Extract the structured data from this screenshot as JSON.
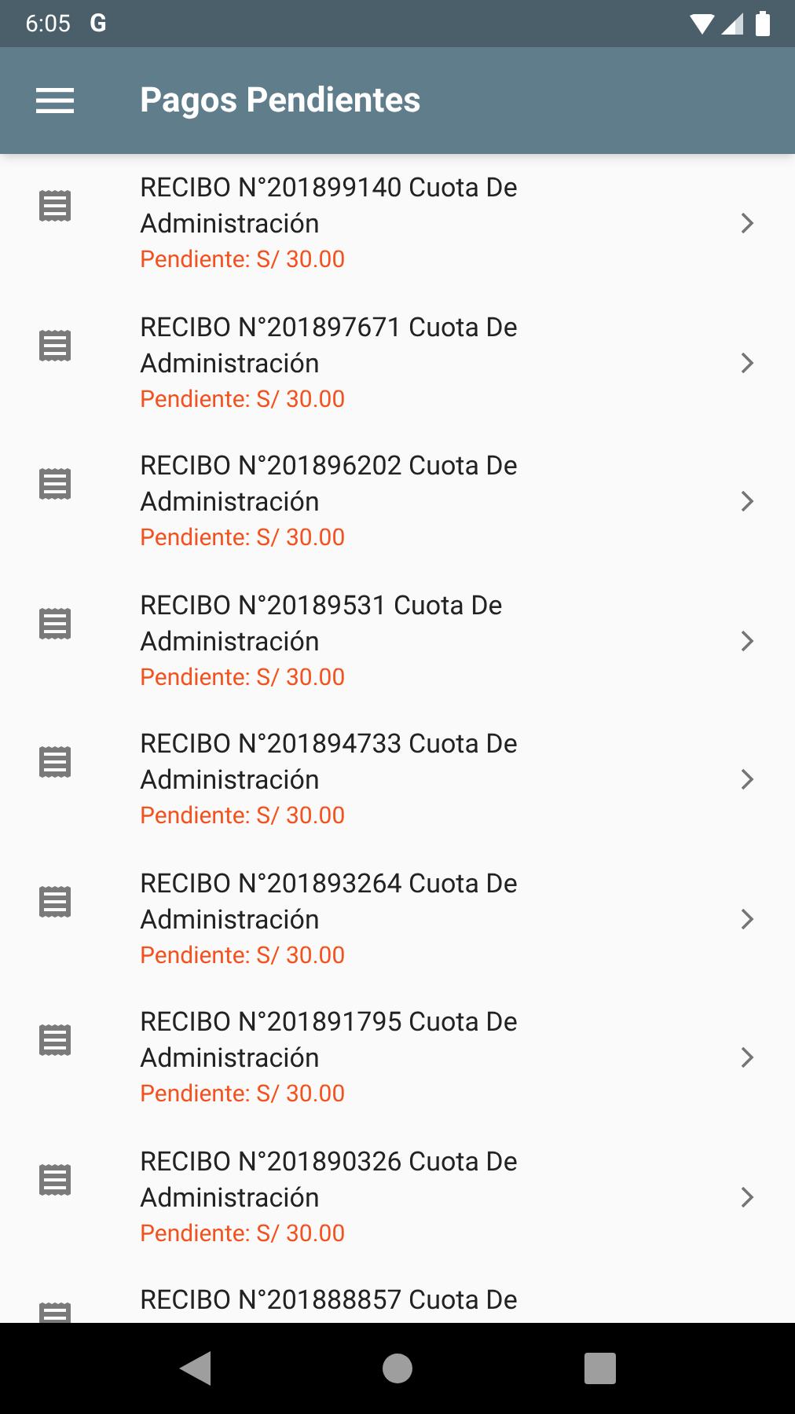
{
  "status_bar": {
    "time": "6:05",
    "app_letter": "G"
  },
  "app_bar": {
    "title": "Pagos Pendientes"
  },
  "items": [
    {
      "title": "RECIBO N°201899140 Cuota De Administración",
      "amount": "Pendiente: S/ 30.00"
    },
    {
      "title": "RECIBO N°201897671 Cuota De Administración",
      "amount": "Pendiente: S/ 30.00"
    },
    {
      "title": "RECIBO N°201896202 Cuota De Administración",
      "amount": "Pendiente: S/ 30.00"
    },
    {
      "title": "RECIBO N°20189531 Cuota De Administración",
      "amount": "Pendiente: S/ 30.00"
    },
    {
      "title": "RECIBO N°201894733 Cuota De Administración",
      "amount": "Pendiente: S/ 30.00"
    },
    {
      "title": "RECIBO N°201893264 Cuota De Administración",
      "amount": "Pendiente: S/ 30.00"
    },
    {
      "title": "RECIBO N°201891795 Cuota De Administración",
      "amount": "Pendiente: S/ 30.00"
    },
    {
      "title": "RECIBO N°201890326 Cuota De Administración",
      "amount": "Pendiente: S/ 30.00"
    },
    {
      "title": "RECIBO N°201888857 Cuota De"
    }
  ]
}
